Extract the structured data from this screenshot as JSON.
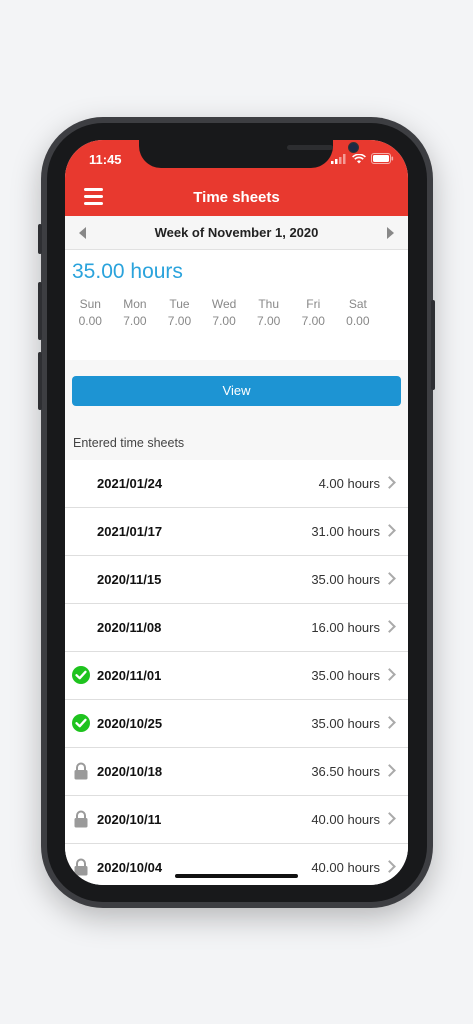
{
  "status_bar": {
    "time": "11:45"
  },
  "header": {
    "title": "Time sheets",
    "menu_icon": "hamburger-menu-icon"
  },
  "week": {
    "label": "Week of November 1, 2020"
  },
  "summary": {
    "total": "35.00 hours",
    "days": [
      {
        "name": "Sun",
        "hours": "0.00"
      },
      {
        "name": "Mon",
        "hours": "7.00"
      },
      {
        "name": "Tue",
        "hours": "7.00"
      },
      {
        "name": "Wed",
        "hours": "7.00"
      },
      {
        "name": "Thu",
        "hours": "7.00"
      },
      {
        "name": "Fri",
        "hours": "7.00"
      },
      {
        "name": "Sat",
        "hours": "0.00"
      }
    ]
  },
  "view_button": {
    "label": "View"
  },
  "entered": {
    "label": "Entered time sheets",
    "rows": [
      {
        "date": "2021/01/24",
        "hours": "4.00 hours",
        "status": "none"
      },
      {
        "date": "2021/01/17",
        "hours": "31.00 hours",
        "status": "none"
      },
      {
        "date": "2020/11/15",
        "hours": "35.00 hours",
        "status": "none"
      },
      {
        "date": "2020/11/08",
        "hours": "16.00 hours",
        "status": "none"
      },
      {
        "date": "2020/11/01",
        "hours": "35.00 hours",
        "status": "approved"
      },
      {
        "date": "2020/10/25",
        "hours": "35.00 hours",
        "status": "approved"
      },
      {
        "date": "2020/10/18",
        "hours": "36.50 hours",
        "status": "locked"
      },
      {
        "date": "2020/10/11",
        "hours": "40.00 hours",
        "status": "locked"
      },
      {
        "date": "2020/10/04",
        "hours": "40.00 hours",
        "status": "locked"
      }
    ]
  },
  "colors": {
    "header": "#e8392f",
    "accent": "#2aa3dc",
    "button": "#1d94d3",
    "approved": "#1ec31e",
    "locked": "#9a9a9a"
  }
}
